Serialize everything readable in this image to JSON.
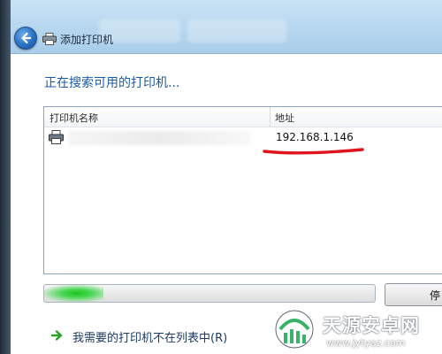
{
  "window": {
    "title": "添加打印机",
    "back_icon": "back-arrow-icon"
  },
  "main": {
    "heading": "正在搜索可用的打印机...",
    "columns": [
      "打印机名称",
      "地址"
    ],
    "printers": [
      {
        "name": "",
        "address": "192.168.1.146",
        "icon": "printer-icon"
      }
    ],
    "progress_percent": 18,
    "stop_label": "停",
    "not_listed_link": "我需要的打印机不在列表中(R)"
  },
  "watermark": {
    "title": "天源安卓网",
    "url": "www.jytyaz.com"
  },
  "colors": {
    "heading": "#1a5ba8",
    "annotation_red": "#e0141c",
    "progress_green": "#19c61d"
  }
}
